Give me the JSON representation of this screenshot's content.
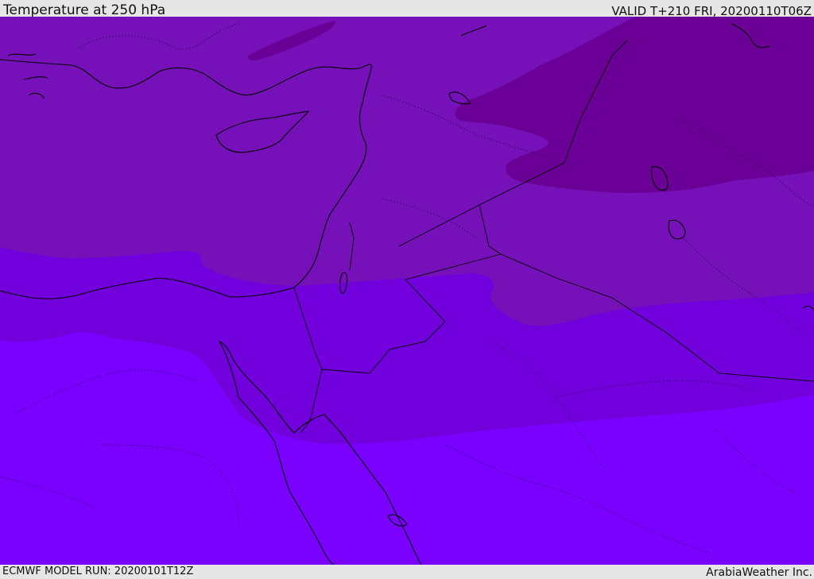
{
  "header": {
    "title": "Temperature at 250 hPa",
    "valid": "VALID T+210 FRI, 20200110T06Z"
  },
  "footer": {
    "model_run": "ECMWF MODEL RUN: 20200101T12Z",
    "credit": "ArabiaWeather Inc."
  },
  "colors": {
    "band_warm": "#7a00ff",
    "band_mid": "#7200dc",
    "band_cool": "#7610b8",
    "band_cold": "#6a0096",
    "coastline": "#000000",
    "frame": "#e6e6e6"
  }
}
